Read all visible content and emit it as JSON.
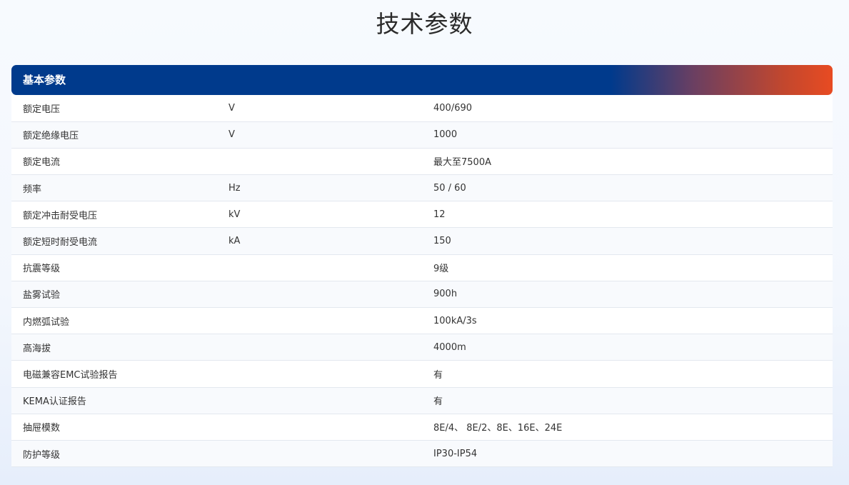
{
  "page": {
    "title": "技术参数"
  },
  "section": {
    "title": "基本参数"
  },
  "rows": [
    {
      "name": "额定电压",
      "unit": "V",
      "value": "400/690"
    },
    {
      "name": "额定绝缘电压",
      "unit": "V",
      "value": "1000"
    },
    {
      "name": "额定电流",
      "unit": "",
      "value": " 最大至7500A"
    },
    {
      "name": "频率",
      "unit": "Hz",
      "value": "50 / 60"
    },
    {
      "name": "额定冲击耐受电压",
      "unit": "kV",
      "value": "12"
    },
    {
      "name": "额定短时耐受电流",
      "unit": "kA",
      "value": "150"
    },
    {
      "name": "抗震等级",
      "unit": "",
      "value": "9级"
    },
    {
      "name": "盐雾试验",
      "unit": "",
      "value": "900h"
    },
    {
      "name": "内燃弧试验",
      "unit": "",
      "value": "100kA/3s"
    },
    {
      "name": "高海拔",
      "unit": "",
      "value": "4000m"
    },
    {
      "name": "电磁兼容EMC试验报告",
      "unit": "",
      "value": "有"
    },
    {
      "name": "KEMA认证报告",
      "unit": "",
      "value": "有"
    },
    {
      "name": "抽屉模数",
      "unit": "",
      "value": "8E/4、 8E/2、8E、16E、24E"
    },
    {
      "name": "防护等级",
      "unit": "",
      "value": "IP30-IP54"
    }
  ],
  "colors": {
    "header_start": "#003a8c",
    "header_end": "#e84b22"
  }
}
